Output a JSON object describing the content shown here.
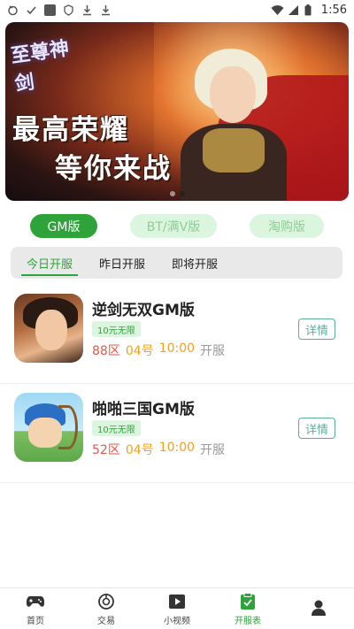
{
  "status_bar": {
    "time": "1:56"
  },
  "banner": {
    "logo_text": "至尊神剑",
    "slogan_line1": "最高荣耀",
    "slogan_line2": "等你来战",
    "page_count": 2,
    "active_page": 2
  },
  "version_tabs": [
    {
      "label": "GM版",
      "active": true
    },
    {
      "label": "BT/满V版",
      "active": false
    },
    {
      "label": "淘购版",
      "active": false
    }
  ],
  "day_tabs": [
    {
      "label": "今日开服",
      "active": true
    },
    {
      "label": "昨日开服",
      "active": false
    },
    {
      "label": "即将开服",
      "active": false
    }
  ],
  "games": [
    {
      "name": "逆剑无双GM版",
      "tag": "10元无限",
      "zone": "88区",
      "date": "04号",
      "time": "10:00",
      "status": "开服",
      "detail_label": "详情"
    },
    {
      "name": "啪啪三国GM版",
      "tag": "10元无限",
      "zone": "52区",
      "date": "04号",
      "time": "10:00",
      "status": "开服",
      "detail_label": "详情"
    }
  ],
  "bottom_nav": [
    {
      "label": "首页",
      "icon": "gamepad-icon",
      "active": false
    },
    {
      "label": "交易",
      "icon": "trade-icon",
      "active": false
    },
    {
      "label": "小视频",
      "icon": "video-icon",
      "active": false
    },
    {
      "label": "开服表",
      "icon": "clipboard-check-icon",
      "active": true
    },
    {
      "label": "",
      "icon": "user-icon",
      "active": false
    }
  ],
  "colors": {
    "accent": "#2ea33a",
    "accent_light": "#dcf5df",
    "zone_red": "#e05a4a",
    "time_orange": "#f0a020",
    "detail_teal": "#58b09a"
  }
}
